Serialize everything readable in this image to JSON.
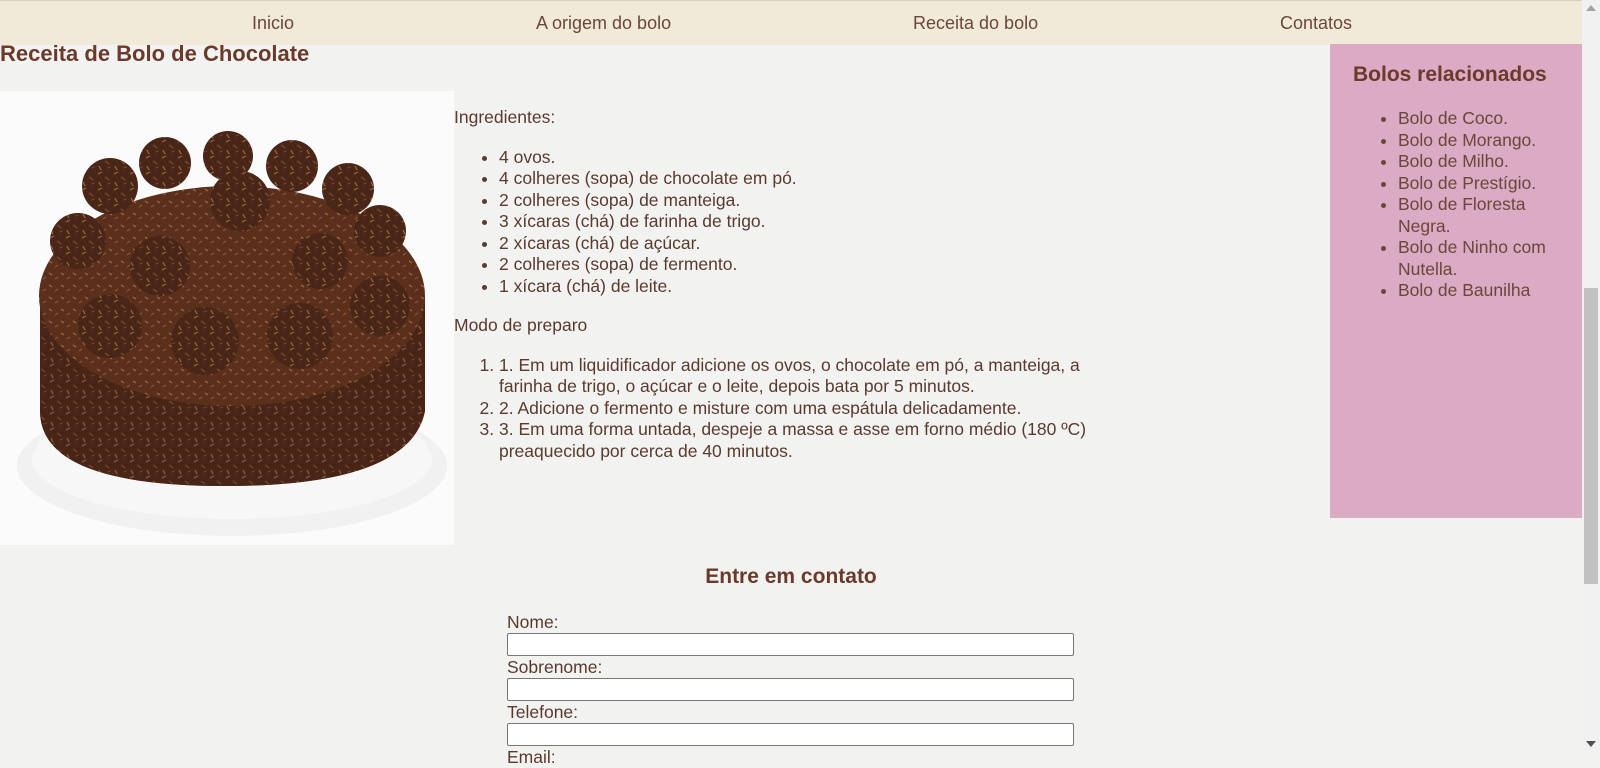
{
  "nav": {
    "items": [
      {
        "label": "Inicio"
      },
      {
        "label": "A origem do bolo"
      },
      {
        "label": "Receita do bolo"
      },
      {
        "label": "Contatos"
      }
    ]
  },
  "page": {
    "title": "Receita de Bolo de Chocolate"
  },
  "recipe": {
    "ingredients_heading": "Ingredientes:",
    "ingredients": [
      "4 ovos.",
      "4 colheres (sopa) de chocolate em pó.",
      "2 colheres (sopa) de manteiga.",
      "3 xícaras (chá) de farinha de trigo.",
      "2 xícaras (chá) de açúcar.",
      "2 colheres (sopa) de fermento.",
      "1 xícara (chá) de leite."
    ],
    "method_heading": "Modo de preparo",
    "steps": [
      "1. Em um liquidificador adicione os ovos, o chocolate em pó, a manteiga, a farinha de trigo, o açúcar e o leite, depois bata por 5 minutos.",
      "2. Adicione o fermento e misture com uma espátula delicadamente.",
      "3. Em uma forma untada, despeje a massa e asse em forno médio (180 ºC) preaquecido por cerca de 40 minutos."
    ]
  },
  "sidebar": {
    "title": "Bolos relacionados",
    "items": [
      "Bolo de Coco.",
      "Bolo de Morango.",
      "Bolo de Milho.",
      "Bolo de Prestígio.",
      "Bolo de Floresta Negra.",
      "Bolo de Ninho com Nutella.",
      "Bolo de Baunilha"
    ]
  },
  "contact": {
    "title": "Entre em contato",
    "fields": [
      {
        "label": "Nome:",
        "value": ""
      },
      {
        "label": "Sobrenome:",
        "value": ""
      },
      {
        "label": "Telefone:",
        "value": ""
      },
      {
        "label": "Email:",
        "value": ""
      }
    ]
  },
  "colors": {
    "nav_background": "#f1ead8",
    "page_background": "#f2f2f1",
    "sidebar_background": "#dbaac4",
    "heading_text": "#6a3a2a",
    "body_text": "#5b3a2e"
  },
  "icons": {
    "cake_image": "chocolate-cake-image",
    "scroll_up": "chevron-up-icon",
    "scroll_down": "chevron-down-icon"
  }
}
